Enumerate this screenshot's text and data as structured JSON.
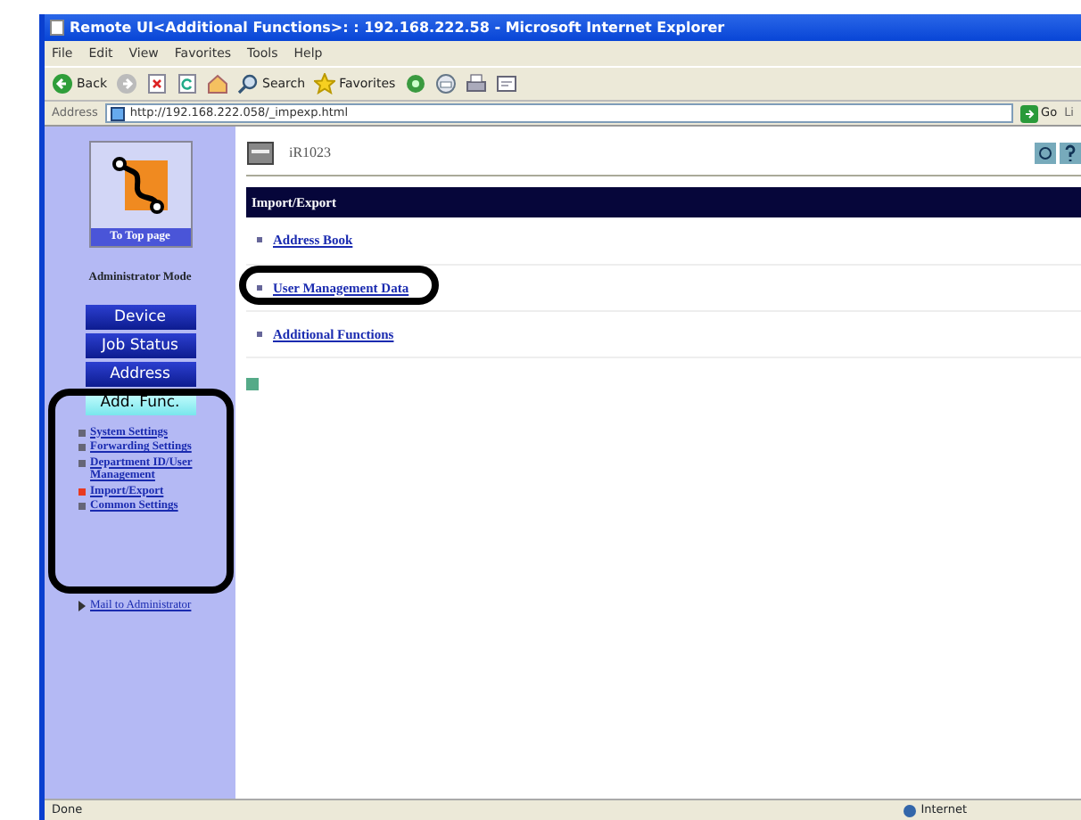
{
  "window": {
    "title": "Remote UI<Additional Functions>: : 192.168.222.58 - Microsoft Internet Explorer"
  },
  "menu": [
    "File",
    "Edit",
    "View",
    "Favorites",
    "Tools",
    "Help"
  ],
  "toolbar": [
    {
      "kind": "back",
      "label": "Back"
    },
    {
      "kind": "forward"
    },
    {
      "kind": "stop"
    },
    {
      "kind": "refresh"
    },
    {
      "kind": "home"
    },
    {
      "kind": "search",
      "label": "Search"
    },
    {
      "kind": "favorites",
      "label": "Favorites"
    },
    {
      "kind": "media"
    },
    {
      "kind": "mail"
    },
    {
      "kind": "print"
    },
    {
      "kind": "edit"
    }
  ],
  "address_bar": {
    "label": "Address",
    "value": "http://192.168.222.058/_impexp.html",
    "go": "Go",
    "links": "Li"
  },
  "sidebar": {
    "top_page": "To Top page",
    "mode": "Administrator Mode",
    "buttons": [
      {
        "label": "Device",
        "selected": false
      },
      {
        "label": "Job Status",
        "selected": false
      },
      {
        "label": "Address",
        "selected": false
      },
      {
        "label": "Add. Func.",
        "selected": true
      }
    ],
    "items": [
      {
        "label": "System Settings",
        "selected": false
      },
      {
        "label": "Forwarding Settings",
        "selected": false
      },
      {
        "label": "Department ID/User Management",
        "selected": false
      },
      {
        "label": "Import/Export",
        "selected": true
      },
      {
        "label": "Common Settings",
        "selected": false
      }
    ],
    "items_highlighted": true,
    "mail": "Mail to Administrator"
  },
  "content": {
    "device": "iR1023",
    "heading": "Import/Export",
    "links": [
      {
        "label": "Address Book",
        "highlighted": false
      },
      {
        "label": "User Management Data",
        "highlighted": true
      },
      {
        "label": "Additional Functions",
        "highlighted": false
      }
    ]
  },
  "status_bar": {
    "text": "Done",
    "zone": "Internet"
  }
}
